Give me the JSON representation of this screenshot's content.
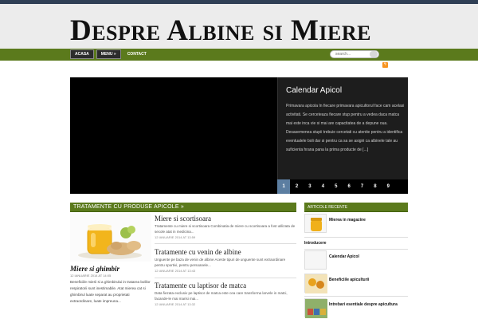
{
  "site": {
    "title": "Despre Albine si Miere"
  },
  "nav": {
    "items": [
      {
        "label": "Acasa"
      },
      {
        "label": "Menu »"
      },
      {
        "label": "Contact"
      }
    ],
    "search_placeholder": "search..."
  },
  "slider": {
    "title": "Calendar Apicol",
    "text": "Primavara apicola In fiecare primavara apicultorul face cam acelasi activitati. Se cerceteaza fiecare stup pentru a vedea daca matca mai este inca vie si mai are capacitatea de a depune oua. Desasemenea stupii trebuie cercetati cu atentie pentru a identifica eventualele boli dar si pentru ca sa se asigiri ca albinele tale au suficienta hrana pana la prima producte de [...]",
    "pages": [
      "1",
      "2",
      "3",
      "4",
      "5",
      "6",
      "7",
      "8",
      "9"
    ]
  },
  "section": {
    "title": "Tratamente cu produse apicole »"
  },
  "featured": {
    "title": "Miere si ghimbir",
    "date": "12 IANUARIE 2014 AT 14:05",
    "excerpt": "Beneficiile mierii si a ghimbirului in tratarea bolilor respiratorii sunt inestimabile. Atat mierea cat si ghimbirul luate separat au proprietati extraordinare, luate impreuna..."
  },
  "posts": [
    {
      "title": "Miere si scortisoara",
      "excerpt": "Tratamente cu miere si scortisoara Combinatia de miere cu scortisoara a fost utilizata de secole atat in medicina...",
      "date": "12 IANUARIE 2014 AT 13:59"
    },
    {
      "title": "Tratamente cu venin de albine",
      "excerpt": "Unguente pe baza de venin de albine Aceste tipuri de unguente sunt extraordinare pentru sportivi, pentru persoanele...",
      "date": "12 IANUARIE 2014 AT 13:43"
    },
    {
      "title": "Tratamente cu laptisor de matca",
      "excerpt": "Data fiezata exclusiv pe laptisor de matca este cea care transforma larvele in matci, facande-le mai marisi mai...",
      "date": "12 IANUARIE 2014 AT 13:32"
    }
  ],
  "sidebar": {
    "title": "Articole recente",
    "items": [
      {
        "label": "Mierea in magazine",
        "thumb": true
      },
      {
        "label": "Introducere",
        "thumb": false
      },
      {
        "label": "Calendar Apicol",
        "thumb": true
      },
      {
        "label": "Beneficiile apiculturii",
        "thumb": true
      },
      {
        "label": "Intrebari esentiale despre apicultura",
        "thumb": true
      }
    ]
  },
  "colors": {
    "accent": "#5b7a1c",
    "pager_active": "#5c7ea1",
    "header_bg": "#ececec",
    "topbar": "#2f3f55"
  }
}
